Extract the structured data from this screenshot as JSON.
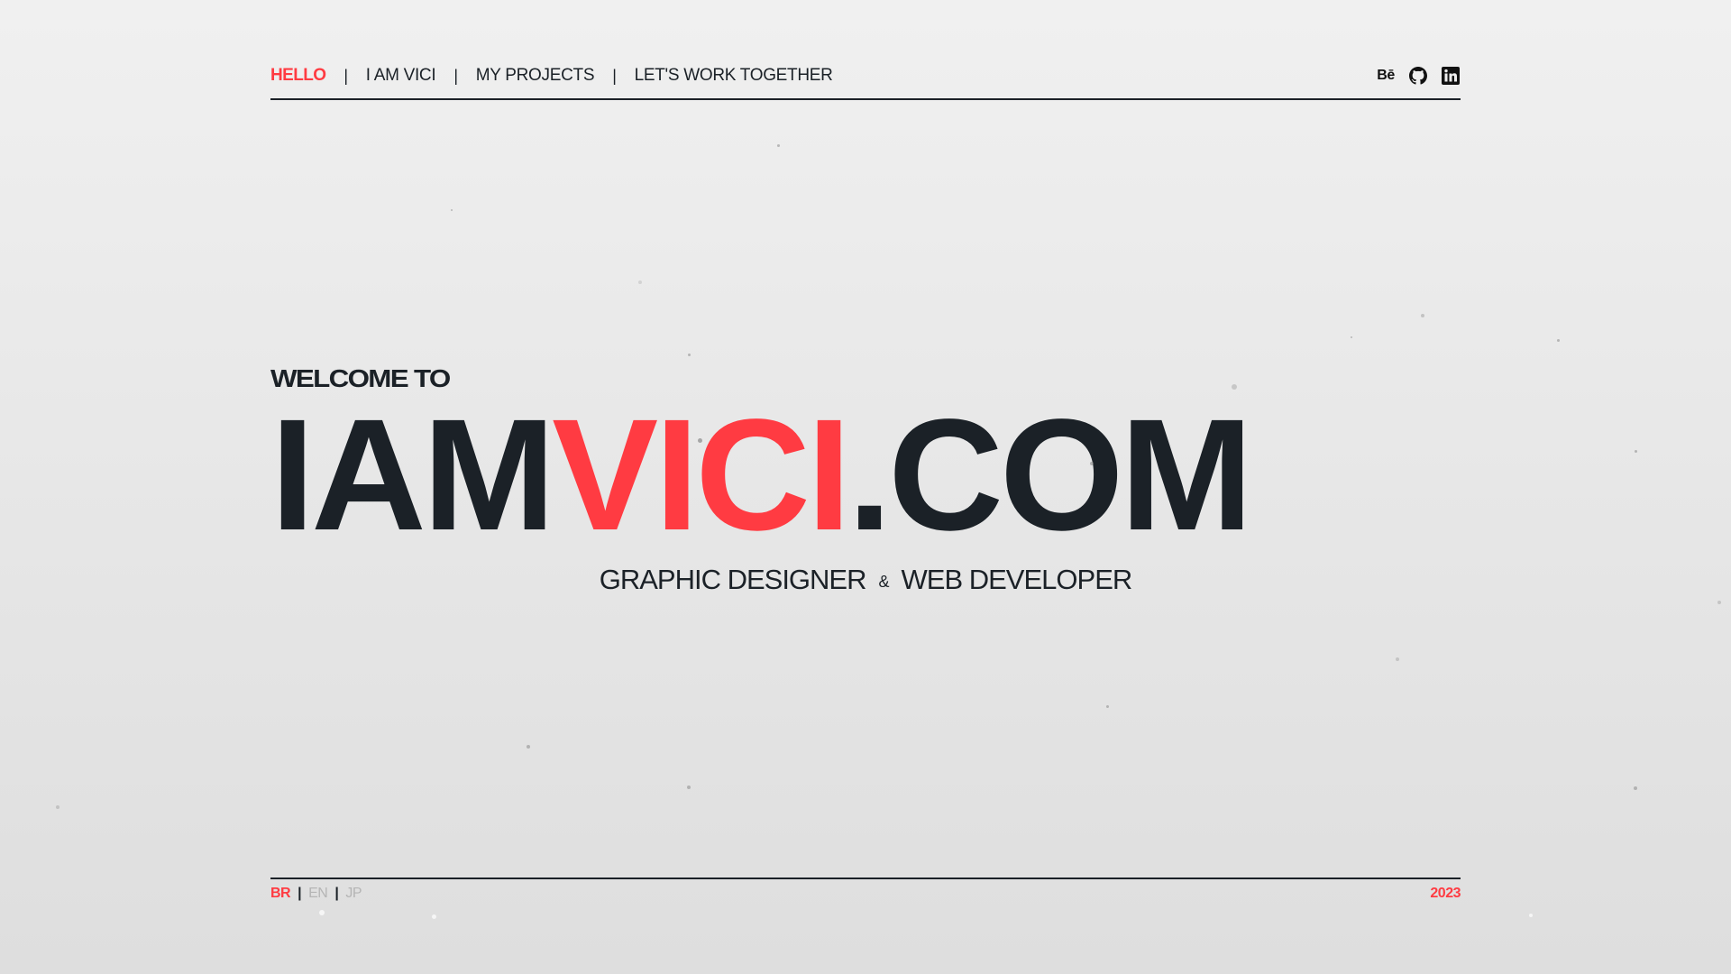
{
  "nav": {
    "links": [
      {
        "label": "HELLO",
        "active": true
      },
      {
        "label": "I AM VICI",
        "active": false
      },
      {
        "label": "MY PROJECTS",
        "active": false
      },
      {
        "label": "LET'S WORK TOGETHER",
        "active": false
      }
    ],
    "separator": "|",
    "social": [
      {
        "name": "behance-icon",
        "label": "Bē"
      },
      {
        "name": "github-icon"
      },
      {
        "name": "linkedin-icon"
      }
    ]
  },
  "hero": {
    "welcome": "WELCOME TO",
    "title_part1": "IAM",
    "title_part2": "VICI",
    "title_part3": ".COM",
    "subtitle_left": "GRAPHIC DESIGNER",
    "subtitle_amp": "&",
    "subtitle_right": "WEB DEVELOPER"
  },
  "footer": {
    "languages": [
      {
        "label": "BR",
        "active": true
      },
      {
        "label": "EN",
        "active": false
      },
      {
        "label": "JP",
        "active": false
      }
    ],
    "lang_separator": "|",
    "year": "2023"
  },
  "colors": {
    "accent": "#ff3b42",
    "dark": "#1b2127",
    "background": "#ebebeb",
    "inactive": "#b5b5b5"
  }
}
